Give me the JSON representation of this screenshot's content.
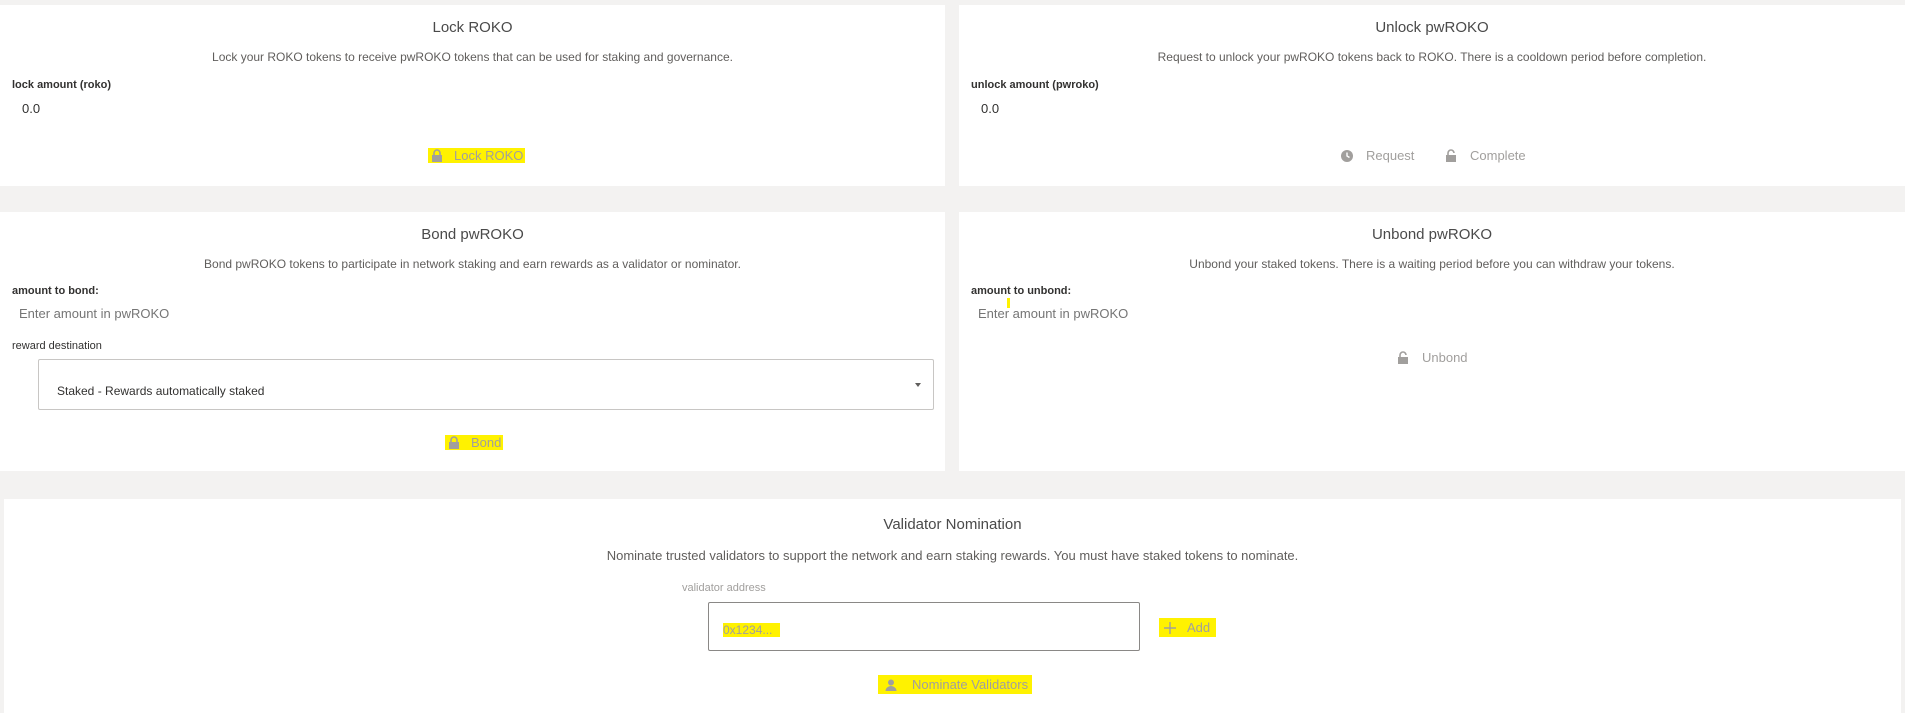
{
  "lock": {
    "title": "Lock ROKO",
    "description": "Lock your ROKO tokens to receive pwROKO tokens that can be used for staking and governance.",
    "amount_label": "lock amount (roko)",
    "amount_value": "0.0",
    "button_label": "Lock ROKO",
    "button_icon": "lock-icon"
  },
  "unlock": {
    "title": "Unlock pwROKO",
    "description": "Request to unlock your pwROKO tokens back to ROKO. There is a cooldown period before completion.",
    "amount_label": "unlock amount (pwroko)",
    "amount_value": "0.0",
    "request_label": "Request",
    "request_icon": "clock-icon",
    "complete_label": "Complete",
    "complete_icon": "unlock-icon"
  },
  "bond": {
    "title": "Bond pwROKO",
    "description": "Bond pwROKO tokens to participate in network staking and earn rewards as a validator or nominator.",
    "amount_label": "amount to bond:",
    "amount_placeholder": "Enter amount in pwROKO",
    "reward_label": "reward destination",
    "reward_selected": "Staked - Rewards automatically staked",
    "button_label": "Bond",
    "button_icon": "lock-icon"
  },
  "unbond": {
    "title": "Unbond pwROKO",
    "description": "Unbond your staked tokens. There is a waiting period before you can withdraw your tokens.",
    "amount_label": "amount to unbond:",
    "amount_placeholder": "Enter amount in pwROKO",
    "button_label": "Unbond",
    "button_icon": "unlock-icon"
  },
  "nomination": {
    "title": "Validator Nomination",
    "description": "Nominate trusted validators to support the network and earn staking rewards. You must have staked tokens to nominate.",
    "address_label": "validator address",
    "address_placeholder": "0x1234...",
    "add_label": "Add",
    "add_icon": "plus-icon",
    "nominate_label": "Nominate Validators",
    "nominate_icon": "person-icon"
  },
  "colors": {
    "background": "#f3f2f1",
    "card": "#ffffff",
    "highlight": "#fff200",
    "disabled_text": "#a19f9d"
  }
}
